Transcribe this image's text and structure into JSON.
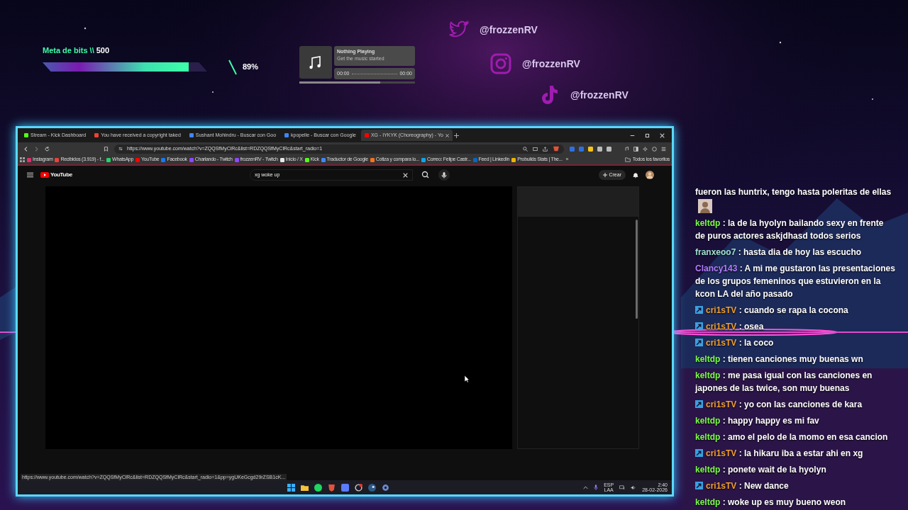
{
  "bits_goal": {
    "label": "Meta de bits \\\\",
    "value": "500",
    "level": 0.89,
    "percent": "89%"
  },
  "music": {
    "title": "Nothing Playing",
    "subtitle": "Get the music started",
    "elapsed": "00:00",
    "total": "00:00",
    "level": 0.7
  },
  "socials": [
    {
      "kind": "twitter",
      "handle": "@frozzenRV"
    },
    {
      "kind": "instagram",
      "handle": "@frozzenRV"
    },
    {
      "kind": "tiktok",
      "handle": "@frozzenRV"
    }
  ],
  "browser": {
    "tabs": [
      {
        "label": "Stream - Kick Dashboard",
        "color": "#53fc18",
        "selected": false
      },
      {
        "label": "You have received a copyright taked",
        "color": "#ea4335",
        "selected": false
      },
      {
        "label": "Sushant Mohindru - Buscar con Goo",
        "color": "#4285f4",
        "selected": false
      },
      {
        "label": "kpopelle - Buscar con Google",
        "color": "#4285f4",
        "selected": false
      },
      {
        "label": "XG - IYKYK (Choreography) - Yo",
        "color": "#ff0000",
        "selected": true
      }
    ],
    "url": "https://www.youtube.com/watch?v=ZQQSfMyClRc&list=RDZQQSfMyClRc&start_radio=1",
    "bookmarks": [
      {
        "label": "Instagram",
        "color": "#e1306c"
      },
      {
        "label": "Recibidos (3.919) - f...",
        "color": "#ea4335"
      },
      {
        "label": "WhatsApp",
        "color": "#25d366"
      },
      {
        "label": "YouTube",
        "color": "#ff0000"
      },
      {
        "label": "Facebook",
        "color": "#1877f2"
      },
      {
        "label": "Charlando - Twitch",
        "color": "#9146ff"
      },
      {
        "label": "frozzenRV - Twitch",
        "color": "#9146ff"
      },
      {
        "label": "Inicio / X",
        "color": "#e5e7eb"
      },
      {
        "label": "Kick",
        "color": "#53fc18"
      },
      {
        "label": "Traductor de Google",
        "color": "#4285f4"
      },
      {
        "label": "Cotiza y compara lo...",
        "color": "#f97316"
      },
      {
        "label": "Correo: Felipe Castr...",
        "color": "#0ea5e9"
      },
      {
        "label": "Feed | LinkedIn",
        "color": "#0a66c2"
      },
      {
        "label": "Probuilds Stats | The...",
        "color": "#eab308"
      }
    ],
    "more_bookmarks": "»",
    "all_bookmarks": "Todos los favoritos",
    "youtube": {
      "logo": "YouTube",
      "search_value": "xg woke up",
      "create": "Crear"
    },
    "status_url": "https://www.youtube.com/watch?v=ZQQSfMyClRc&list=RDZQQSfMyClRc&start_radio=1&pp=ygUKeGcgd29rZSB1cK..."
  },
  "taskbar": {
    "language": "ESP",
    "layout": "LAA",
    "time": "2:40",
    "date": "28-02-2026"
  },
  "chat": [
    {
      "text": "fueron las huntrix, tengo hasta poleritas de ellas",
      "emote": true
    },
    {
      "user": "keltdp",
      "separator": ":",
      "color": "#7cfc4a",
      "badge": false,
      "text": "la de la hyolyn bailando sexy en frente de puros actores askjdhasd todos serios"
    },
    {
      "user": "franxeoo7",
      "separator": ":",
      "color": "#9fe0d0",
      "badge": false,
      "text": "hasta dia de hoy las escucho"
    },
    {
      "user": "Clancy143",
      "separator": ":",
      "color": "#b57cff",
      "badge": false,
      "text": "A mi me gustaron las presentaciones de los grupos femeninos que estuvieron en la kcon LA del año pasado"
    },
    {
      "user": "cri1sTV",
      "separator": ":",
      "color": "#f0a030",
      "badge": true,
      "text": "cuando se rapa la cocona"
    },
    {
      "user": "cri1sTV",
      "separator": ":",
      "color": "#f0a030",
      "badge": true,
      "text": "osea"
    },
    {
      "user": "cri1sTV",
      "separator": ":",
      "color": "#f0a030",
      "badge": true,
      "text": "la coco"
    },
    {
      "user": "keltdp",
      "separator": ":",
      "color": "#7cfc4a",
      "badge": false,
      "text": "tienen canciones muy buenas wn"
    },
    {
      "user": "keltdp",
      "separator": ":",
      "color": "#7cfc4a",
      "badge": false,
      "text": "me pasa igual con las canciones en japones de las twice, son muy buenas"
    },
    {
      "user": "cri1sTV",
      "separator": ":",
      "color": "#f0a030",
      "badge": true,
      "text": "yo con las canciones de kara"
    },
    {
      "user": "keltdp",
      "separator": ":",
      "color": "#7cfc4a",
      "badge": false,
      "text": "happy happy es mi fav"
    },
    {
      "user": "keltdp",
      "separator": ":",
      "color": "#7cfc4a",
      "badge": false,
      "text": "amo el pelo de la momo en esa cancion"
    },
    {
      "user": "cri1sTV",
      "separator": ":",
      "color": "#f0a030",
      "badge": true,
      "text": "la hikaru iba a estar ahi en xg"
    },
    {
      "user": "keltdp",
      "separator": ":",
      "color": "#7cfc4a",
      "badge": false,
      "text": "ponete wait de la hyolyn"
    },
    {
      "user": "cri1sTV",
      "separator": ":",
      "color": "#f0a030",
      "badge": true,
      "text": "New dance"
    },
    {
      "user": "keltdp",
      "separator": ":",
      "color": "#7cfc4a",
      "badge": false,
      "text": "woke up es muy bueno weon"
    }
  ]
}
